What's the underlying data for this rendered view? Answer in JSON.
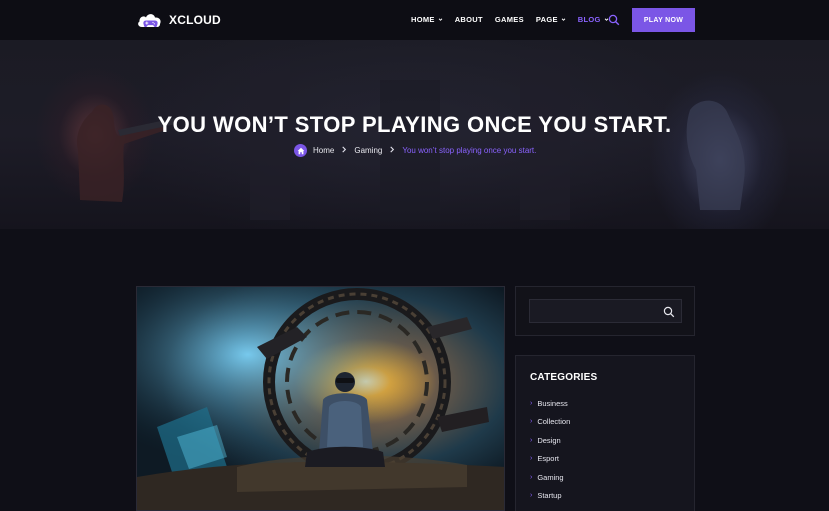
{
  "brand": {
    "name": "XCLOUD"
  },
  "nav": {
    "items": [
      {
        "label": "HOME",
        "has_dropdown": true,
        "active": false
      },
      {
        "label": "ABOUT",
        "has_dropdown": false,
        "active": false
      },
      {
        "label": "GAMES",
        "has_dropdown": false,
        "active": false
      },
      {
        "label": "PAGE",
        "has_dropdown": true,
        "active": false
      },
      {
        "label": "BLOG",
        "has_dropdown": true,
        "active": true
      }
    ],
    "cta_label": "PLAY NOW"
  },
  "hero": {
    "title": "YOU WON’T STOP PLAYING ONCE YOU START.",
    "breadcrumb": {
      "home": "Home",
      "category": "Gaming",
      "current": "You won’t stop playing once you start."
    }
  },
  "sidebar": {
    "search": {
      "placeholder": "",
      "value": ""
    },
    "categories": {
      "title": "CATEGORIES",
      "items": [
        "Business",
        "Collection",
        "Design",
        "Esport",
        "Gaming",
        "Startup"
      ]
    }
  },
  "colors": {
    "accent": "#7b56e6",
    "accent_text": "#8a63ff",
    "background": "#0f0f17",
    "nav_background": "#0d0d14"
  },
  "icons": {
    "logo": "cloud-gamepad-icon",
    "search": "search-icon",
    "home": "home-icon",
    "chevron": "chevron-down-icon",
    "breadcrumb_separator": "chevron-right-icon"
  }
}
